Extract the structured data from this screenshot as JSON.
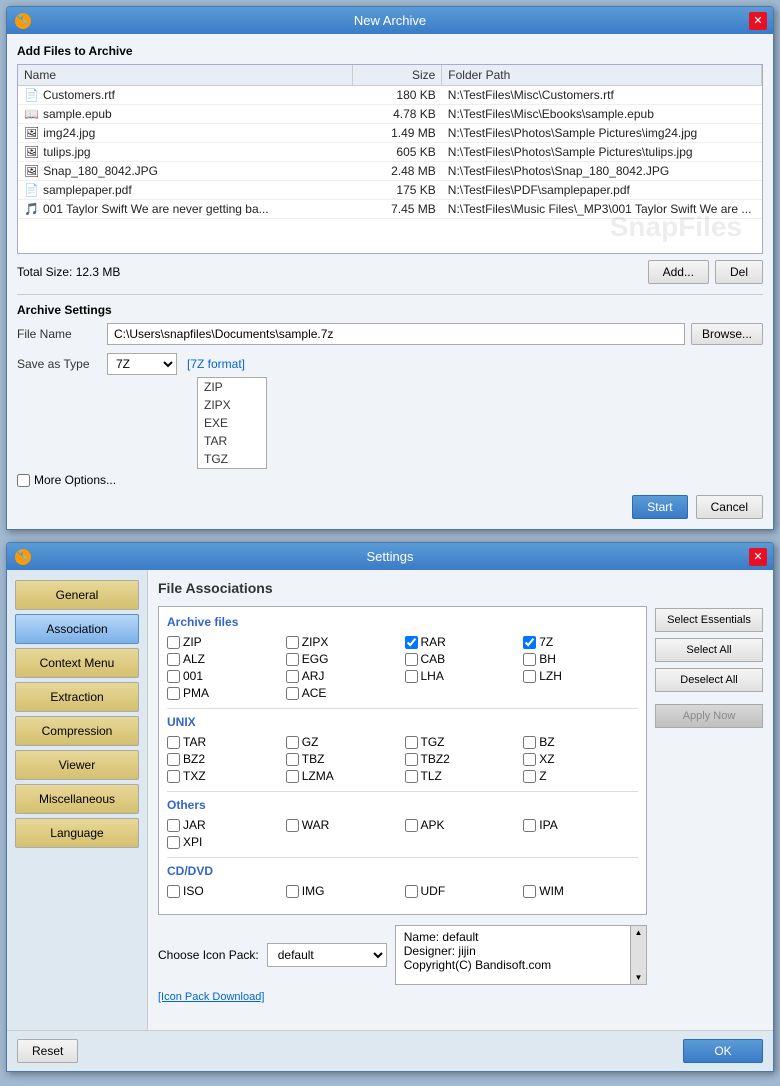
{
  "archive_window": {
    "title": "New Archive",
    "icon": "🔧",
    "section": "Add Files to Archive",
    "columns": [
      "Name",
      "Size",
      "Folder Path"
    ],
    "files": [
      {
        "icon": "📄",
        "name": "Customers.rtf",
        "size": "180 KB",
        "path": "N:\\TestFiles\\Misc\\Customers.rtf"
      },
      {
        "icon": "📖",
        "name": "sample.epub",
        "size": "4.78 KB",
        "path": "N:\\TestFiles\\Misc\\Ebooks\\sample.epub"
      },
      {
        "icon": "🖼",
        "name": "img24.jpg",
        "size": "1.49 MB",
        "path": "N:\\TestFiles\\Photos\\Sample Pictures\\img24.jpg"
      },
      {
        "icon": "🖼",
        "name": "tulips.jpg",
        "size": "605 KB",
        "path": "N:\\TestFiles\\Photos\\Sample Pictures\\tulips.jpg"
      },
      {
        "icon": "🖼",
        "name": "Snap_180_8042.JPG",
        "size": "2.48 MB",
        "path": "N:\\TestFiles\\Photos\\Snap_180_8042.JPG"
      },
      {
        "icon": "📄",
        "name": "samplepaper.pdf",
        "size": "175 KB",
        "path": "N:\\TestFiles\\PDF\\samplepaper.pdf"
      },
      {
        "icon": "🎵",
        "name": "001 Taylor Swift We are never getting ba...",
        "size": "7.45 MB",
        "path": "N:\\TestFiles\\Music Files\\_MP3\\001 Taylor Swift We are ..."
      }
    ],
    "total_size_label": "Total Size: 12.3 MB",
    "add_btn": "Add...",
    "del_btn": "Del",
    "settings_section": "Archive Settings",
    "file_name_label": "File Name",
    "file_name_value": "C:\\Users\\snapfiles\\Documents\\sample.7z",
    "browse_btn": "Browse...",
    "save_type_label": "Save as Type",
    "save_type_value": "7Z",
    "format_hint": "[7Z format]",
    "more_options": "More Options...",
    "start_btn": "Start",
    "cancel_btn": "Cancel",
    "dropdown": {
      "items": [
        "ZIP",
        "ZIPX",
        "EXE",
        "TAR",
        "TGZ"
      ]
    }
  },
  "settings_window": {
    "title": "Settings",
    "sidebar": [
      {
        "label": "General",
        "active": false
      },
      {
        "label": "Association",
        "active": true
      },
      {
        "label": "Context Menu",
        "active": false
      },
      {
        "label": "Extraction",
        "active": false
      },
      {
        "label": "Compression",
        "active": false
      },
      {
        "label": "Viewer",
        "active": false
      },
      {
        "label": "Miscellaneous",
        "active": false
      },
      {
        "label": "Language",
        "active": false
      }
    ],
    "content_title": "File Associations",
    "groups": {
      "archive": {
        "title": "Archive files",
        "items": [
          {
            "label": "ZIP",
            "checked": false
          },
          {
            "label": "ZIPX",
            "checked": false
          },
          {
            "label": "RAR",
            "checked": true
          },
          {
            "label": "7Z",
            "checked": true
          },
          {
            "label": "ALZ",
            "checked": false
          },
          {
            "label": "EGG",
            "checked": false
          },
          {
            "label": "CAB",
            "checked": false
          },
          {
            "label": "BH",
            "checked": false
          },
          {
            "label": "001",
            "checked": false
          },
          {
            "label": "ARJ",
            "checked": false
          },
          {
            "label": "LHA",
            "checked": false
          },
          {
            "label": "LZH",
            "checked": false
          },
          {
            "label": "PMA",
            "checked": false
          },
          {
            "label": "ACE",
            "checked": false
          },
          {
            "label": "",
            "checked": false
          },
          {
            "label": "",
            "checked": false
          }
        ]
      },
      "unix": {
        "title": "UNIX",
        "items": [
          {
            "label": "TAR",
            "checked": false
          },
          {
            "label": "GZ",
            "checked": false
          },
          {
            "label": "TGZ",
            "checked": false
          },
          {
            "label": "BZ",
            "checked": false
          },
          {
            "label": "BZ2",
            "checked": false
          },
          {
            "label": "TBZ",
            "checked": false
          },
          {
            "label": "TBZ2",
            "checked": false
          },
          {
            "label": "XZ",
            "checked": false
          },
          {
            "label": "TXZ",
            "checked": false
          },
          {
            "label": "LZMA",
            "checked": false
          },
          {
            "label": "TLZ",
            "checked": false
          },
          {
            "label": "Z",
            "checked": false
          }
        ]
      },
      "others": {
        "title": "Others",
        "items": [
          {
            "label": "JAR",
            "checked": false
          },
          {
            "label": "WAR",
            "checked": false
          },
          {
            "label": "APK",
            "checked": false
          },
          {
            "label": "IPA",
            "checked": false
          },
          {
            "label": "XPI",
            "checked": false
          }
        ]
      },
      "cddvd": {
        "title": "CD/DVD",
        "items": [
          {
            "label": "ISO",
            "checked": false
          },
          {
            "label": "IMG",
            "checked": false
          },
          {
            "label": "UDF",
            "checked": false
          },
          {
            "label": "WIM",
            "checked": false
          }
        ]
      }
    },
    "right_buttons": {
      "select_essentials": "Select Essentials",
      "select_all": "Select All",
      "deselect_all": "Deselect All"
    },
    "icon_pack_label": "Choose Icon Pack:",
    "icon_pack_value": "default",
    "icon_pack_info": {
      "name": "Name: default",
      "designer": "Designer: jijin",
      "copyright": "Copyright(C) Bandisoft.com"
    },
    "icon_pack_link": "[Icon Pack Download]",
    "footer": {
      "reset_btn": "Reset",
      "ok_btn": "OK",
      "apply_btn": "Apply Now"
    }
  }
}
